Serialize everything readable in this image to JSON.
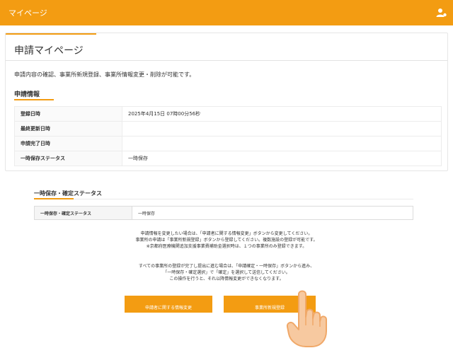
{
  "header": {
    "title": "マイページ",
    "user_icon": "user-icon",
    "bg_color": "#f39c12"
  },
  "main": {
    "page_title": "申請マイページ",
    "description": "申請内容の確認、事業所新規登録、事業所情報変更・削除が可能です。",
    "section_title": "申請情報",
    "info_rows": [
      {
        "label": "登録日時",
        "value": "2025年4月15日 07時00分56秒"
      },
      {
        "label": "最終更新日時",
        "value": ""
      },
      {
        "label": "申請完了日時",
        "value": ""
      },
      {
        "label": "一時保存ステータス",
        "value": "一時保存"
      }
    ]
  },
  "status_section": {
    "title": "一時保存・確定ステータス",
    "row_label": "一時保存・確定ステータス",
    "row_value": "一時保存"
  },
  "notice": {
    "lines_1": [
      "申請情報を変更したい場合は、「申請者に関する情報変更」ボタンから変更してください。",
      "事業所の申請は「事業所新規登録」ボタンから登録してください。複数施設の登録が可能です。",
      "※京都府医療機関追加支援事業費補助金選択時は、１つの事業所のみ登録できます。"
    ],
    "lines_2": [
      "すべての事業所の登録が完了し提出に進む場合は、「申請確定・一時保存」ボタンから進み、",
      "「一時保存・確定選択」で「確定」を選択して送信してください。",
      "この操作を行うと、それ以降情報変更ができなくなります。"
    ]
  },
  "buttons": {
    "change_applicant": "申請者に関する情報変更",
    "register_office": "事業所新規登録"
  },
  "colors": {
    "accent": "#f39c12"
  },
  "icons": {
    "pointer": "pointing-hand-icon"
  }
}
